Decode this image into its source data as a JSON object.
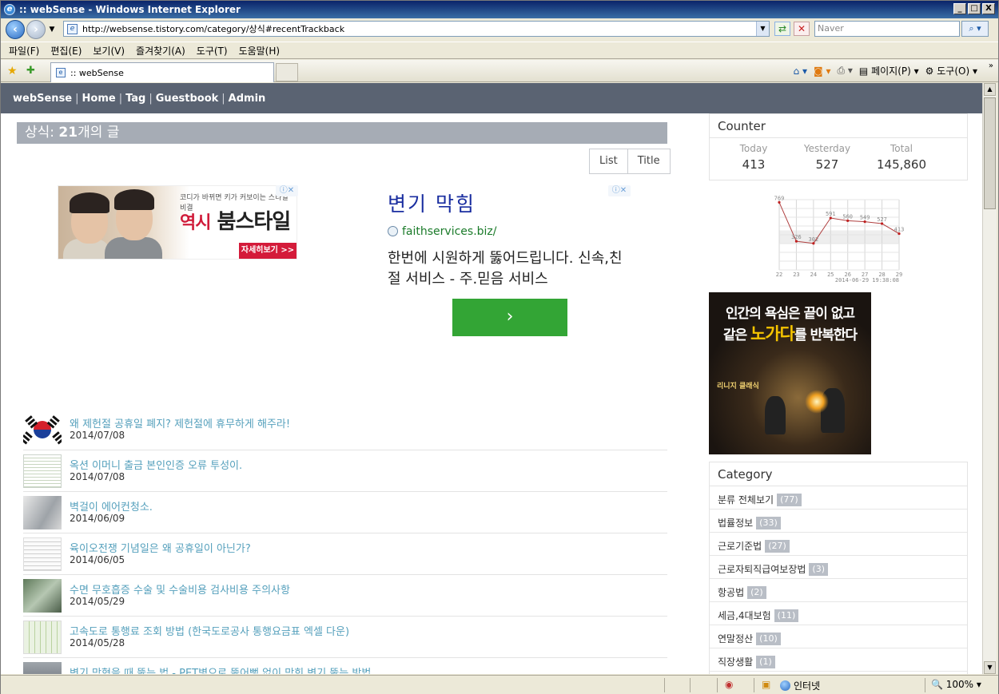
{
  "window": {
    "title": ":: webSense - Windows Internet Explorer",
    "controls": [
      "_",
      "□",
      "X"
    ]
  },
  "address": {
    "url": "http://websense.tistory.com/category/상식#recentTrackback",
    "search_placeholder": "Naver"
  },
  "menu": [
    "파일(F)",
    "편집(E)",
    "보기(V)",
    "즐겨찾기(A)",
    "도구(T)",
    "도움말(H)"
  ],
  "tab": {
    "title": ":: webSense"
  },
  "commandbar": {
    "page": "페이지(P)",
    "tools": "도구(O)"
  },
  "sitenav": {
    "items": [
      "webSense",
      "Home",
      "Tag",
      "Guestbook",
      "Admin"
    ],
    "separator": "|"
  },
  "page": {
    "heading_prefix": "상식:",
    "heading_count": "21",
    "heading_suffix": "개의 글",
    "view_list": "List",
    "view_title": "Title"
  },
  "ad1": {
    "tagline": "코디가 바뀌면 키가 커보이는 스타일 비결",
    "brand_prefix": "역시",
    "brand": "붐스타일",
    "cta": "자세히보기 >>"
  },
  "ad2": {
    "title": "변기 막힘",
    "url": "faithservices.biz/",
    "desc": "한번에 시원하게 뚫어드립니다. 신속,친절 서비스 - 주.믿음 서비스",
    "button": "›"
  },
  "posts": [
    {
      "title": "왜 제헌절 공휴일 폐지? 제헌절에 휴무하게 해주라!",
      "date": "2014/07/08",
      "thumb": "korean-flag"
    },
    {
      "title": "옥션 이머니 출금 본인인증 오류 투성이.",
      "date": "2014/07/08",
      "thumb": "screenshot"
    },
    {
      "title": "벽걸이 에어컨청소.",
      "date": "2014/06/09",
      "thumb": "air-conditioner"
    },
    {
      "title": "육이오전쟁 기념일은 왜 공휴일이 아닌가?",
      "date": "2014/06/05",
      "thumb": "document"
    },
    {
      "title": "수면 무호흡증 수술 및 수술비용 검사비용 주의사항",
      "date": "2014/05/29",
      "thumb": "photo"
    },
    {
      "title": "고속도로 통행료 조회 방법 (한국도로공사 통행요금표 엑셀 다운)",
      "date": "2014/05/28",
      "thumb": "spreadsheet"
    },
    {
      "title": "변기 막혔을 때 뚫는 법 - PET병으로 뚫어뻥 없이 막힌 변기 뚫는 방법",
      "date": "",
      "thumb": "photo"
    }
  ],
  "counter": {
    "title": "Counter",
    "today_label": "Today",
    "today": "413",
    "yesterday_label": "Yesterday",
    "yesterday": "527",
    "total_label": "Total",
    "total": "145,860"
  },
  "chart_data": {
    "type": "line",
    "x": [
      "22",
      "23",
      "24",
      "25",
      "26",
      "27",
      "28",
      "29"
    ],
    "values": [
      769,
      326,
      302,
      591,
      560,
      549,
      527,
      413
    ],
    "value_labels": [
      "769",
      "326",
      "302",
      "591",
      "560",
      "549",
      "527",
      "413"
    ],
    "footer": "2014-06-29  19:38:08",
    "ylim": [
      0,
      800
    ],
    "grid": true
  },
  "gamead": {
    "line1": "인간의 욕심은 끝이 없고",
    "line2_prefix": "같은 ",
    "line2_em": "노가다",
    "line2_suffix": "를 반복한다",
    "logo": "리니지 클래식"
  },
  "category": {
    "title": "Category",
    "items": [
      {
        "label": "분류 전체보기",
        "count": "(77)"
      },
      {
        "label": "법률정보",
        "count": "(33)"
      },
      {
        "label": "근로기준법",
        "count": "(27)"
      },
      {
        "label": "근로자퇴직급여보장법",
        "count": "(3)"
      },
      {
        "label": "항공법",
        "count": "(2)"
      },
      {
        "label": "세금,4대보험",
        "count": "(11)"
      },
      {
        "label": "연말정산",
        "count": "(10)"
      },
      {
        "label": "직장생활",
        "count": "(1)"
      }
    ]
  },
  "status": {
    "zone": "인터넷",
    "zoom": "100%"
  },
  "colors": {
    "nav_bg": "#5a6372",
    "post_link": "#55a0bc",
    "heading_bg": "#a6acb5",
    "ad_green": "#33a535"
  }
}
